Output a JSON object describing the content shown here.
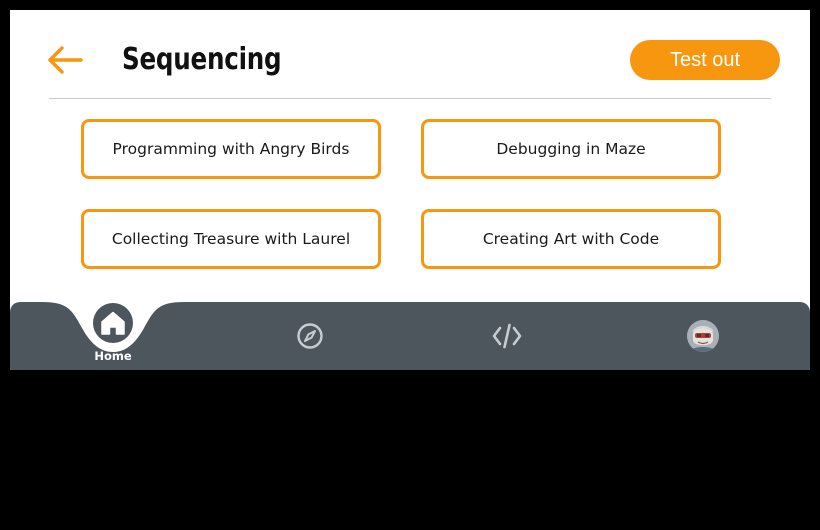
{
  "header": {
    "title": "Sequencing",
    "test_button_label": "Test out",
    "back_icon": "arrow-left-icon"
  },
  "lessons": [
    {
      "label": "Programming with Angry Birds"
    },
    {
      "label": "Debugging in Maze"
    },
    {
      "label": "Collecting Treasure with Laurel"
    },
    {
      "label": "Creating Art with Code"
    }
  ],
  "bottom_nav": {
    "items": [
      {
        "label": "Home",
        "icon": "home-icon",
        "active": true
      },
      {
        "label": "",
        "icon": "compass-icon",
        "active": false
      },
      {
        "label": "",
        "icon": "code-icon",
        "active": false
      },
      {
        "label": "",
        "icon": "avatar-icon",
        "active": false
      }
    ]
  },
  "colors": {
    "accent": "#f7960f",
    "nav_background": "#4d555d",
    "background": "#ffffff",
    "text": "#1a1a1a"
  }
}
